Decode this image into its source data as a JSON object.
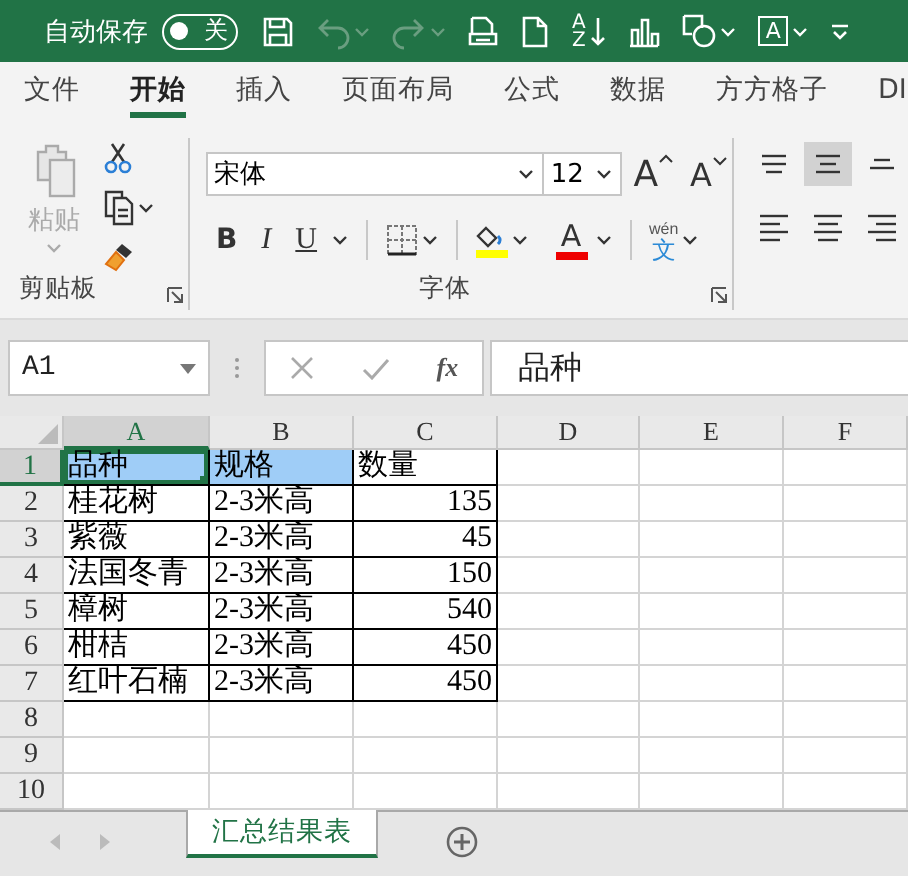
{
  "title_bar": {
    "autosave_label": "自动保存",
    "autosave": {
      "on": false,
      "label": "关"
    },
    "quick_access": [
      {
        "kind": "save"
      },
      {
        "kind": "undo",
        "disabled": true
      },
      {
        "kind": "redo",
        "disabled": true
      },
      {
        "kind": "print_preview"
      },
      {
        "kind": "new_file"
      },
      {
        "kind": "sort",
        "glyphs": [
          "A",
          "Z"
        ]
      },
      {
        "kind": "chart"
      },
      {
        "kind": "shapes"
      },
      {
        "kind": "text_box",
        "glyphs": [
          "A"
        ]
      },
      {
        "kind": "customize"
      }
    ]
  },
  "tabs": [
    {
      "label": "文件",
      "selected": false
    },
    {
      "label": "开始",
      "selected": true
    },
    {
      "label": "插入",
      "selected": false
    },
    {
      "label": "页面布局",
      "selected": false
    },
    {
      "label": "公式",
      "selected": false
    },
    {
      "label": "数据",
      "selected": false
    },
    {
      "label": "方方格子",
      "selected": false
    },
    {
      "label": "DI",
      "selected": false
    }
  ],
  "ribbon": {
    "clipboard": {
      "paste_label": "粘贴",
      "paste_disabled": true,
      "label": "剪贴板"
    },
    "font": {
      "font_name": "宋体",
      "font_size": "12",
      "grow_glyph": "A",
      "shrink_glyph": "A",
      "format_buttons": [
        {
          "kind": "bold",
          "label": "B"
        },
        {
          "kind": "italic",
          "label": "I"
        },
        {
          "kind": "underline",
          "label": "U"
        }
      ],
      "font_color_glyph": "A",
      "phonetic": {
        "top": "wén",
        "bottom": "文"
      },
      "label": "字体"
    },
    "alignment": {
      "buttons": [
        {
          "kind": "top",
          "selected": false
        },
        {
          "kind": "middle",
          "selected": true
        },
        {
          "kind": "bottom",
          "selected": false
        },
        {
          "kind": "left",
          "selected": false
        },
        {
          "kind": "center",
          "selected": false
        },
        {
          "kind": "right",
          "selected": false
        }
      ]
    }
  },
  "formula_bar": {
    "name_box": "A1",
    "fx": "fx",
    "value": "品种"
  },
  "sheet": {
    "columns": [
      {
        "label": "A",
        "selected": true
      },
      {
        "label": "B",
        "selected": false
      },
      {
        "label": "C",
        "selected": false
      },
      {
        "label": "D",
        "selected": false
      },
      {
        "label": "E",
        "selected": false
      },
      {
        "label": "F",
        "selected": false
      }
    ],
    "rows": [
      {
        "label": "1",
        "selected": true,
        "cells": [
          {
            "text": "品种",
            "kind": "text",
            "selected": true,
            "highlighted": true
          },
          {
            "text": "规格",
            "kind": "text",
            "selected": false,
            "highlighted": true
          },
          {
            "text": "数量",
            "kind": "text",
            "selected": false,
            "highlighted": false
          }
        ]
      },
      {
        "label": "2",
        "selected": false,
        "cells": [
          {
            "text": "桂花树",
            "kind": "text",
            "selected": false,
            "highlighted": false
          },
          {
            "text": "2-3米高",
            "kind": "text",
            "selected": false,
            "highlighted": false
          },
          {
            "text": "135",
            "kind": "number",
            "selected": false,
            "highlighted": false
          }
        ]
      },
      {
        "label": "3",
        "selected": false,
        "cells": [
          {
            "text": "紫薇",
            "kind": "text",
            "selected": false,
            "highlighted": false
          },
          {
            "text": "2-3米高",
            "kind": "text",
            "selected": false,
            "highlighted": false
          },
          {
            "text": "45",
            "kind": "number",
            "selected": false,
            "highlighted": false
          }
        ]
      },
      {
        "label": "4",
        "selected": false,
        "cells": [
          {
            "text": "法国冬青",
            "kind": "text",
            "selected": false,
            "highlighted": false
          },
          {
            "text": "2-3米高",
            "kind": "text",
            "selected": false,
            "highlighted": false
          },
          {
            "text": "150",
            "kind": "number",
            "selected": false,
            "highlighted": false
          }
        ]
      },
      {
        "label": "5",
        "selected": false,
        "cells": [
          {
            "text": "樟树",
            "kind": "text",
            "selected": false,
            "highlighted": false
          },
          {
            "text": "2-3米高",
            "kind": "text",
            "selected": false,
            "highlighted": false
          },
          {
            "text": "540",
            "kind": "number",
            "selected": false,
            "highlighted": false
          }
        ]
      },
      {
        "label": "6",
        "selected": false,
        "cells": [
          {
            "text": "柑桔",
            "kind": "text",
            "selected": false,
            "highlighted": false
          },
          {
            "text": "2-3米高",
            "kind": "text",
            "selected": false,
            "highlighted": false
          },
          {
            "text": "450",
            "kind": "number",
            "selected": false,
            "highlighted": false
          }
        ]
      },
      {
        "label": "7",
        "selected": false,
        "cells": [
          {
            "text": "红叶石楠",
            "kind": "text",
            "selected": false,
            "highlighted": false
          },
          {
            "text": "2-3米高",
            "kind": "text",
            "selected": false,
            "highlighted": false
          },
          {
            "text": "450",
            "kind": "number",
            "selected": false,
            "highlighted": false
          }
        ]
      },
      {
        "label": "8",
        "selected": false
      },
      {
        "label": "9",
        "selected": false
      },
      {
        "label": "10",
        "selected": false
      }
    ]
  },
  "sheet_tabs": [
    {
      "label": "汇总结果表",
      "selected": true
    }
  ]
}
